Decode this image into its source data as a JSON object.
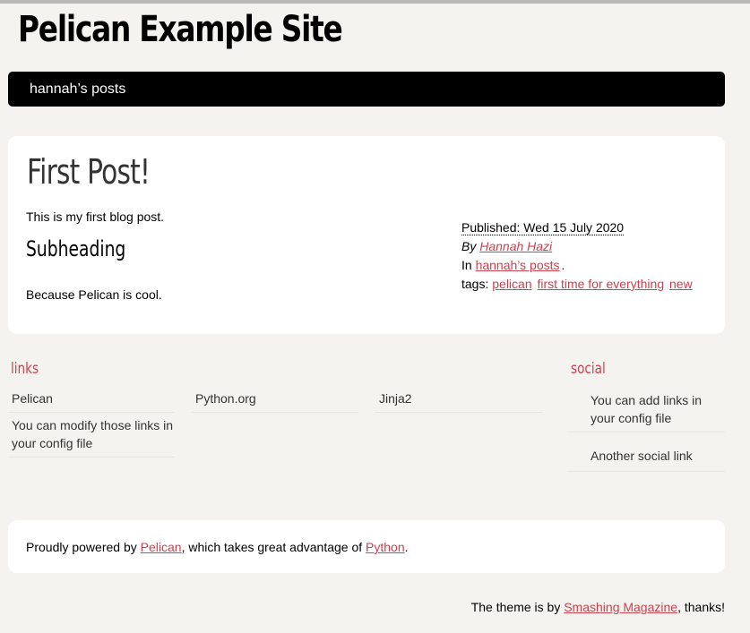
{
  "site": {
    "title": "Pelican Example Site"
  },
  "menu": {
    "item": "hannah’s posts"
  },
  "post": {
    "title": "First Post!",
    "paragraph1": "This is my first blog post.",
    "subheading": "Subheading",
    "paragraph2": "Because Pelican is cool."
  },
  "meta": {
    "published": "Published: Wed 15 July 2020",
    "by_label": "By",
    "author": "Hannah Hazi",
    "in_label": "In",
    "category": "hannah’s posts",
    "category_suffix": ".",
    "tags_label": "tags:",
    "tags": [
      "pelican",
      "first time for everything",
      "new"
    ]
  },
  "blogroll": {
    "title": "links",
    "links": [
      "Pelican",
      "Python.org",
      "Jinja2",
      "You can modify those links in your config file"
    ]
  },
  "social": {
    "title": "social",
    "links": [
      "You can add links in your config file",
      "Another social link"
    ]
  },
  "footer": {
    "prefix": "Proudly powered by",
    "pelican": "Pelican",
    "middle": ", which takes great advantage of",
    "python": "Python",
    "suffix": "."
  },
  "credit": {
    "prefix": "The theme is by",
    "link": "Smashing Magazine",
    "suffix": ", thanks!"
  },
  "colors": {
    "accent": "#c74350",
    "menu_bg": "#000000",
    "page_bg": "#f4f3ef"
  }
}
